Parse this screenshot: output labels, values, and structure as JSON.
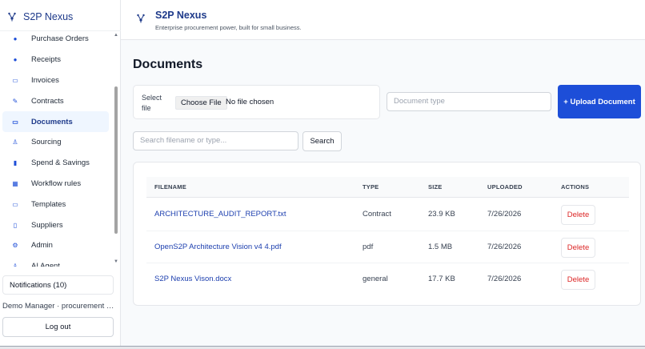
{
  "sidebar": {
    "brand": "S2P Nexus",
    "brand_icon": "nexus-logo-icon",
    "items": [
      {
        "label": "Purchase Orders",
        "icon": "bullet-icon",
        "glyph": "●"
      },
      {
        "label": "Receipts",
        "icon": "bullet-icon",
        "glyph": "●"
      },
      {
        "label": "Invoices",
        "icon": "folder-icon",
        "glyph": "▭"
      },
      {
        "label": "Contracts",
        "icon": "edit-icon",
        "glyph": "✎"
      },
      {
        "label": "Documents",
        "icon": "folder-icon",
        "glyph": "▭",
        "active": true
      },
      {
        "label": "Sourcing",
        "icon": "people-icon",
        "glyph": "♙"
      },
      {
        "label": "Spend & Savings",
        "icon": "bar-chart-icon",
        "glyph": "▮"
      },
      {
        "label": "Workflow rules",
        "icon": "grid-icon",
        "glyph": "▦"
      },
      {
        "label": "Templates",
        "icon": "folder-icon",
        "glyph": "▭"
      },
      {
        "label": "Suppliers",
        "icon": "document-icon",
        "glyph": "▯"
      },
      {
        "label": "Admin",
        "icon": "gear-icon",
        "glyph": "⚙"
      },
      {
        "label": "AI Agent",
        "icon": "people-icon",
        "glyph": "♙"
      }
    ],
    "notifications_label": "Notifications (10)",
    "user_label": "Demo Manager · procurement m...",
    "logout_label": "Log out"
  },
  "header": {
    "title": "S2P Nexus",
    "tagline": "Enterprise procurement power, built for small business."
  },
  "main": {
    "page_title": "Documents",
    "upload": {
      "select_label": "Select file",
      "choose_label": "Choose File",
      "no_file_label": "No file chosen",
      "doc_type_placeholder": "Document type",
      "upload_button": "+ Upload Document"
    },
    "search": {
      "placeholder": "Search filename or type...",
      "button": "Search"
    },
    "table": {
      "headers": [
        "FILENAME",
        "TYPE",
        "SIZE",
        "UPLOADED",
        "ACTIONS"
      ],
      "rows": [
        {
          "filename": "ARCHITECTURE_AUDIT_REPORT.txt",
          "type": "Contract",
          "size": "23.9 KB",
          "uploaded": "7/26/2026",
          "action": "Delete"
        },
        {
          "filename": "OpenS2P Architecture Vision v4 4.pdf",
          "type": "pdf",
          "size": "1.5 MB",
          "uploaded": "7/26/2026",
          "action": "Delete"
        },
        {
          "filename": "S2P Nexus Vison.docx",
          "type": "general",
          "size": "17.7 KB",
          "uploaded": "7/26/2026",
          "action": "Delete"
        }
      ]
    }
  },
  "colors": {
    "brand": "#1e3a8a",
    "primary_button": "#1d4ed8",
    "danger": "#dc2626",
    "active_bg": "#eff6ff"
  }
}
